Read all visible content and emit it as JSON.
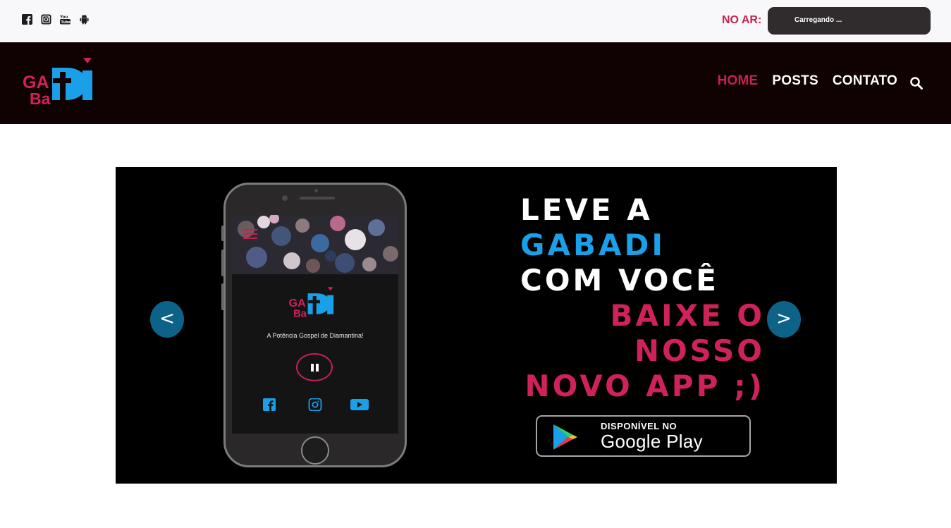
{
  "topbar": {
    "social_icons": [
      "facebook-icon",
      "instagram-icon",
      "youtube-icon",
      "android-icon"
    ],
    "onair_label": "NO AR:",
    "onair_status": "Carregando ..."
  },
  "header": {
    "logo": {
      "text_ga": "GA",
      "text_ba": "Ba",
      "text_di": "DI"
    },
    "nav": [
      {
        "label": "HOME",
        "active": true
      },
      {
        "label": "POSTS",
        "active": false
      },
      {
        "label": "CONTATO",
        "active": false
      }
    ],
    "search_icon": "search-icon"
  },
  "banner": {
    "phone": {
      "tagline": "A Potência Gospel de Diamantina!",
      "icons": [
        "menu-icon",
        "pause-icon",
        "facebook-icon",
        "instagram-icon",
        "youtube-icon"
      ]
    },
    "headline": {
      "line1": "LEVE A",
      "line2": "GABADI",
      "line3": "COM VOCÊ",
      "line4": "BAIXE O",
      "line5": "NOSSO",
      "line6": "NOVO APP ;)"
    },
    "google_play": {
      "small": "DISPONÍVEL NO",
      "big": "Google Play"
    },
    "prev_label": "<",
    "next_label": ">"
  },
  "colors": {
    "accent_pink": "#c5224f",
    "accent_blue": "#1aa0e8",
    "header_bg": "#100102",
    "arrow_bg": "#0d6288"
  }
}
